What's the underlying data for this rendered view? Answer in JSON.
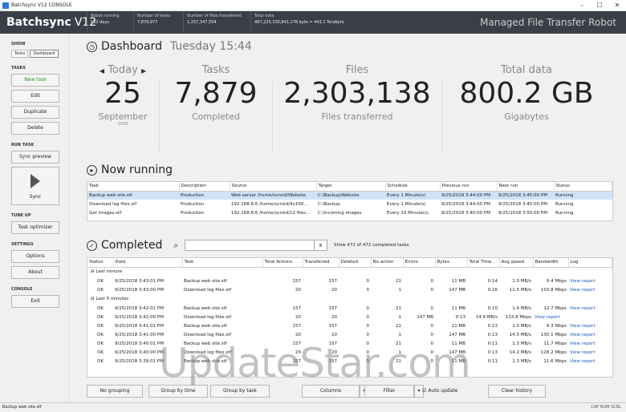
{
  "window": {
    "title": "Batchsync V12 CONSOLE"
  },
  "header": {
    "brand_bold": "Batchsync",
    "brand_version": "V12",
    "stats": [
      {
        "label": "Robot running",
        "value": "532 days"
      },
      {
        "label": "Number of tasks",
        "value": "7,879,977"
      },
      {
        "label": "Number of files transferred",
        "value": "1,257,347,554"
      },
      {
        "label": "Total data",
        "value": "487,225,330,841,176 byte = 443.1 Terabyte"
      }
    ],
    "tagline": "Managed File Transfer Robot"
  },
  "sidebar": {
    "show_label": "SHOW",
    "show_tasks": "Tasks",
    "show_dashboard": "Dashboard",
    "tasks_label": "TASKS",
    "new_task": "New task",
    "edit": "Edit",
    "duplicate": "Duplicate",
    "delete": "Delete",
    "run_task_label": "RUN TASK",
    "sync_preview": "Sync preview",
    "sync": "Sync",
    "tune_up_label": "TUNE UP",
    "task_optimizer": "Task optimizer",
    "settings_label": "SETTINGS",
    "options": "Options",
    "about": "About",
    "console_label": "CONSOLE",
    "exit": "Exit"
  },
  "dashboard": {
    "title": "Dashboard",
    "datetime": "Tuesday 15:44",
    "today": {
      "label": "Today",
      "value": "25",
      "caption": "September",
      "year": "2018"
    },
    "tasks": {
      "label": "Tasks",
      "value": "7,879",
      "caption": "Completed"
    },
    "files": {
      "label": "Files",
      "value": "2,303,138",
      "caption": "Files transferred"
    },
    "data": {
      "label": "Total data",
      "value": "800.2 GB",
      "caption": "Gigabytes"
    }
  },
  "now_running": {
    "title": "Now running",
    "columns": [
      "Task",
      "Description",
      "Source",
      "Target",
      "Schedule",
      "Previous run",
      "Next run",
      "Status"
    ],
    "rows": [
      [
        "Backup web site.stf",
        "Production",
        "Web server /home/ocroid/Website",
        "C:\\Backup\\Website",
        "Every 1 Minute(s)",
        "9/25/2018 3:44:00 PM",
        "9/25/2018 3:45:00 PM",
        "Running"
      ],
      [
        "Download log files.stf",
        "Production",
        "192.168.8.6 /home/ocroid/4x100...",
        "C:\\Backup",
        "Every 1 Minute(s)",
        "9/25/2018 3:44:00 PM",
        "9/25/2018 3:45:00 PM",
        "Running"
      ],
      [
        "Get images.stf",
        "Production",
        "192.168.8.6 /home/ocroid/12 files...",
        "C:\\Incoming images",
        "Every 10 Minute(s)",
        "9/25/2018 3:40:00 PM",
        "9/25/2018 3:50:00 PM",
        "Running"
      ]
    ]
  },
  "completed": {
    "title": "Completed",
    "filter_placeholder": "",
    "clear_x": "x",
    "count_text": "Show 472 of 472 completed tasks",
    "columns": [
      "Status",
      "Date",
      "Task",
      "Total Actions",
      "Transferred",
      "Deleted",
      "No action",
      "Errors",
      "Bytes",
      "Total Time",
      "Avg speed",
      "Bandwidth",
      "Log"
    ],
    "groups": [
      {
        "name": "Last minute",
        "rows": [
          [
            "OK",
            "9/25/2018 3:43:01 PM",
            "Backup web site.stf",
            "157",
            "157",
            "0",
            "21",
            "0",
            "11 MB",
            "0:14",
            "1.0 MB/s",
            "9.4 Mbps",
            "View report"
          ],
          [
            "OK",
            "9/25/2018 3:43:00 PM",
            "Download log files.stf",
            "20",
            "20",
            "0",
            "1",
            "0",
            "147 MB",
            "0:16",
            "11.5 MB/s",
            "103.8 Mbps",
            "View report"
          ]
        ]
      },
      {
        "name": "Last 5 minutes",
        "rows": [
          [
            "OK",
            "9/25/2018 3:42:01 PM",
            "Backup web site.stf",
            "157",
            "157",
            "0",
            "21",
            "0",
            "11 MB",
            "0:10",
            "1.4 MB/s",
            "12.7 Mbps",
            "View report"
          ],
          [
            "OK",
            "9/25/2018 3:42:00 PM",
            "Download log files.stf",
            "20",
            "20",
            "0",
            "1",
            "147 MB",
            "0:13",
            "14.9 MB/s",
            "133.8 Mbps",
            "View report"
          ],
          [
            "OK",
            "9/25/2018 3:41:01 PM",
            "Backup web site.stf",
            "157",
            "157",
            "0",
            "21",
            "0",
            "11 MB",
            "0:13",
            "1.0 MB/s",
            "9.3 Mbps",
            "View report"
          ],
          [
            "OK",
            "9/25/2018 3:41:00 PM",
            "Download log files.stf",
            "20",
            "20",
            "0",
            "1",
            "0",
            "147 MB",
            "0:13",
            "14.5 MB/s",
            "130.1 Mbps",
            "View report"
          ],
          [
            "OK",
            "9/25/2018 3:40:01 PM",
            "Backup web site.stf",
            "157",
            "157",
            "0",
            "21",
            "0",
            "11 MB",
            "0:11",
            "1.3 MB/s",
            "11.7 Mbps",
            "View report"
          ],
          [
            "OK",
            "9/25/2018 3:40:00 PM",
            "Download log files.stf",
            "20",
            "20",
            "0",
            "1",
            "0",
            "147 MB",
            "0:13",
            "14.2 MB/s",
            "128.2 Mbps",
            "View report"
          ],
          [
            "OK",
            "9/25/2018 3:39:01 PM",
            "Backup web site.stf",
            "157",
            "157",
            "0",
            "21",
            "0",
            "11 MB",
            "0:11",
            "1.3 MB/s",
            "11.6 Mbps",
            "View report"
          ]
        ]
      }
    ]
  },
  "toolbar": {
    "no_grouping": "No grouping",
    "group_by_time": "Group by time",
    "group_by_task": "Group by task",
    "columns": "Columns",
    "filter": "Filter",
    "auto_update": "Auto update",
    "clear_history": "Clear history"
  },
  "statusbar": {
    "text": "Backup web site.stf",
    "keys": "CAP  NUM  SCRL"
  },
  "watermark": "UpdateStar.com"
}
